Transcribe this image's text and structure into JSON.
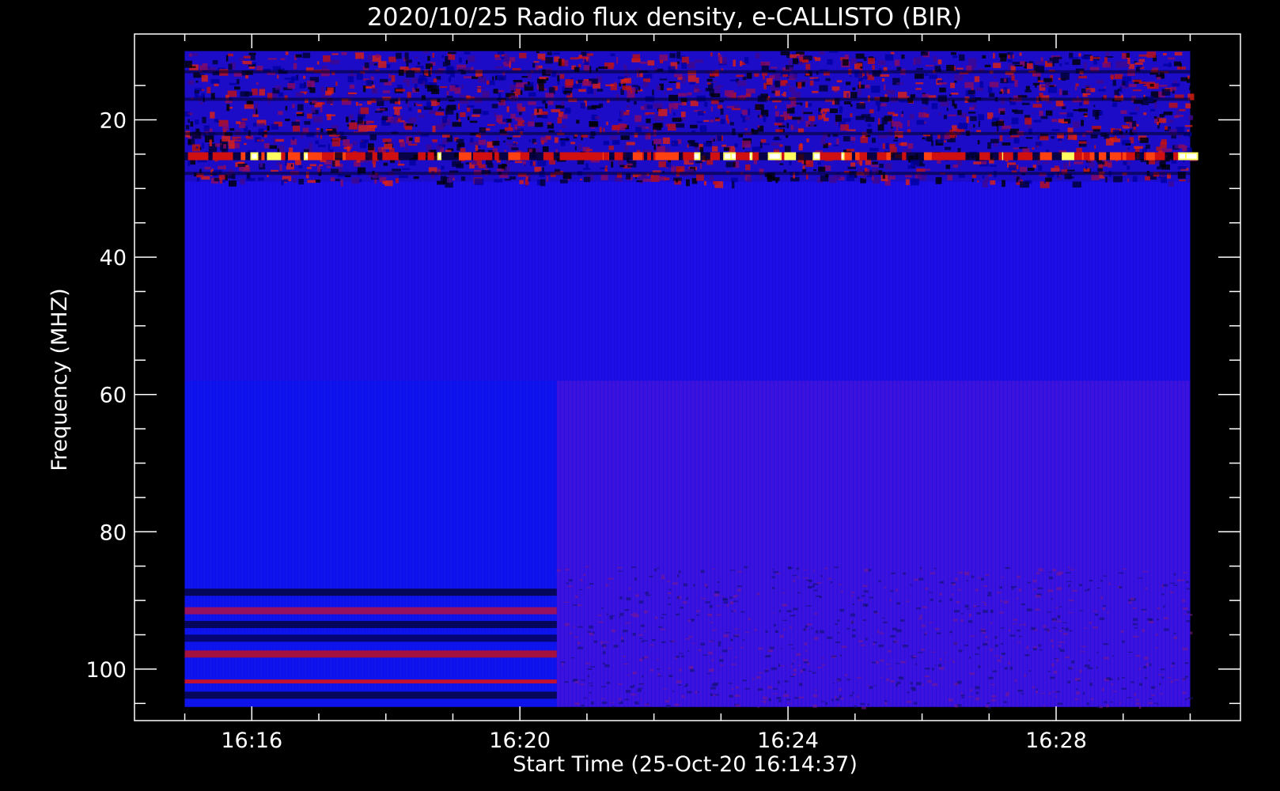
{
  "chart_data": {
    "type": "heatmap",
    "title": "2020/10/25  Radio flux density, e-CALLISTO (BIR)",
    "xlabel": "Start Time (25-Oct-20 16:14:37)",
    "ylabel": "Frequency (MHZ)",
    "x_ticks": [
      {
        "label": "16:16",
        "minutes": 16
      },
      {
        "label": "16:20",
        "minutes": 20
      },
      {
        "label": "16:24",
        "minutes": 24
      },
      {
        "label": "16:28",
        "minutes": 28
      }
    ],
    "x_minor_minutes": [
      15,
      17,
      18,
      19,
      21,
      22,
      23,
      25,
      26,
      27,
      29,
      30
    ],
    "xlim_minutes": [
      14.25,
      30.75
    ],
    "data_x_range_minutes": [
      15.0,
      30.0
    ],
    "y_ticks": [
      20,
      40,
      60,
      80,
      100
    ],
    "y_minor": [
      15,
      25,
      30,
      35,
      45,
      50,
      55,
      65,
      70,
      75,
      85,
      90,
      95,
      105
    ],
    "ylim": [
      107.5,
      7.5
    ],
    "data_y_range": [
      10,
      105.5
    ],
    "grid": false,
    "colormap": [
      "#000000",
      "#0000ff",
      "#ff0000",
      "#ffff00",
      "#ffffff"
    ],
    "features": {
      "rfi_band_mhz": [
        10,
        29
      ],
      "bright_line_mhz": 25.3,
      "step_change_minutes": 20.55,
      "lower_bands_before_step_mhz": [
        88.8,
        91.5,
        93.5,
        95.5,
        97.8,
        101.8,
        103.8
      ],
      "lower_band_region_start_mhz": 58
    }
  }
}
